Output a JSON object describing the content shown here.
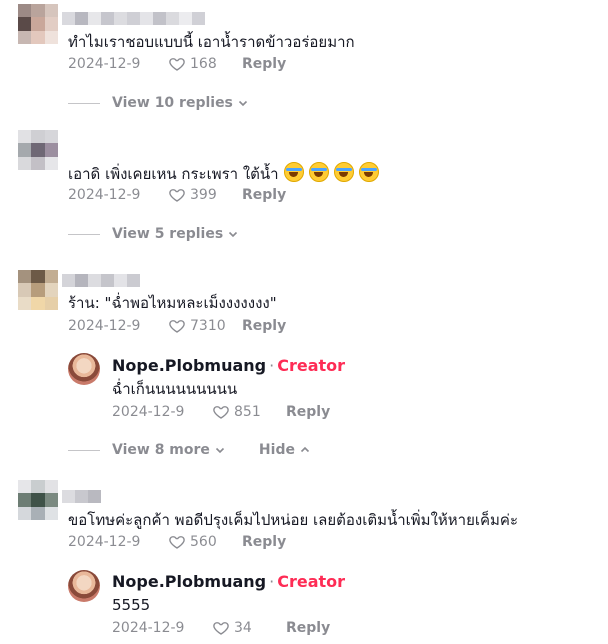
{
  "comments": [
    {
      "text": "ทำไมเราชอบแบบนี้ เอาน้ำราดข้าวอร่อยมาก",
      "date": "2024-12-9",
      "likes": "168",
      "reply_label": "Reply",
      "view_replies": "View 10 replies"
    },
    {
      "text": "เอาดิ เพิ่งเคยเหน กระเพรา ใต้น้ำ",
      "date": "2024-12-9",
      "likes": "399",
      "reply_label": "Reply",
      "view_replies": "View 5 replies"
    },
    {
      "text": "ร้าน: \"ฉ่ำพอไหมหละเม็งงงงงงง\"",
      "date": "2024-12-9",
      "likes": "7310",
      "reply_label": "Reply",
      "reply": {
        "username": "Nope.Plobmuang",
        "badge": "Creator",
        "text": "ฉ่ำเก็นนนนนนนนน",
        "date": "2024-12-9",
        "likes": "851",
        "reply_label": "Reply"
      },
      "view_more": "View 8 more",
      "hide": "Hide"
    },
    {
      "text": "ขอโทษค่ะลูกค้า พอดีปรุงเค็มไปหน่อย เลยต้องเติมน้ำเพิ่มให้หายเค็มค่ะ",
      "date": "2024-12-9",
      "likes": "560",
      "reply_label": "Reply",
      "reply": {
        "username": "Nope.Plobmuang",
        "badge": "Creator",
        "text": "5555",
        "date": "2024-12-9",
        "likes": "34",
        "reply_label": "Reply"
      }
    }
  ],
  "colors": {
    "creator_badge": "#fe2c55",
    "meta": "#8a8b91",
    "text": "#161823"
  }
}
